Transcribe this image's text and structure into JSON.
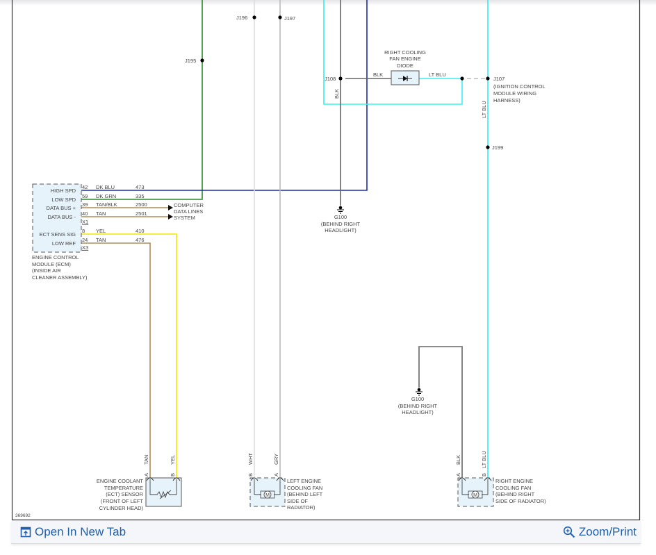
{
  "diagram_id": "369692",
  "colors": {
    "dk_blu": "#1a2fa0",
    "dk_grn": "#2a8a2a",
    "tan": "#b08d57",
    "yel": "#f2e600",
    "lt_blu": "#33f0f0",
    "blk": "#666666",
    "wht": "#dddddd",
    "gry": "#bbbbbb"
  },
  "splices": {
    "j195": "J195",
    "j196": "J196",
    "j197": "J197",
    "j108": "J108",
    "j107": "J107",
    "j199": "J199"
  },
  "j107_desc": [
    "(IGNITION CONTROL",
    "MODULE WIRING",
    "HARNESS)"
  ],
  "diode": {
    "title": [
      "RIGHT COOLING",
      "FAN ENGINE",
      "DIODE"
    ],
    "in_wire": "BLK",
    "out_wire": "LT BLU"
  },
  "vertical_labels": {
    "blk_j108": "BLK",
    "lt_blu_j107": "LT BLU"
  },
  "ground_top": {
    "id": "G100",
    "desc": [
      "(BEHIND RIGHT",
      "HEADLIGHT)"
    ]
  },
  "ground_bottom": {
    "id": "G100",
    "desc": [
      "(BEHIND RIGHT",
      "HEADLIGHT)"
    ]
  },
  "ecm": {
    "pins": [
      {
        "label": "HIGH SPD",
        "pin": "42",
        "color": "DK BLU",
        "circuit": "473"
      },
      {
        "label": "LOW SPD",
        "pin": "59",
        "color": "DK GRN",
        "circuit": "335"
      },
      {
        "label": "DATA BUS +",
        "pin": "39",
        "color": "TAN/BLK",
        "circuit": "2500"
      },
      {
        "label": "DATA BUS -",
        "pin": "40",
        "color": "TAN",
        "circuit": "2501"
      },
      {
        "label": "ECT SENS SIG",
        "pin": "8",
        "color": "YEL",
        "circuit": "410"
      },
      {
        "label": "LOW REF",
        "pin": "24",
        "color": "TAN",
        "circuit": "476"
      }
    ],
    "connectors": [
      "X1",
      "X3"
    ],
    "name": [
      "ENGINE CONTROL",
      "MODULE (ECM)",
      "(INSIDE AIR",
      "CLEANER ASSEMBLY)"
    ]
  },
  "data_lines": [
    "COMPUTER",
    "DATA LINES",
    "SYSTEM"
  ],
  "ect_sensor": {
    "pins": [
      "A",
      "B"
    ],
    "wires": [
      "TAN",
      "YEL"
    ],
    "name": [
      "ENGINE COOLANT",
      "TEMPERATURE",
      "(ECT) SENSOR",
      "(FRONT OF LEFT",
      "CYLINDER HEAD)"
    ]
  },
  "left_fan": {
    "pins": [
      "B",
      "A"
    ],
    "wires": [
      "WHT",
      "GRY"
    ],
    "motor": "M",
    "name": [
      "LEFT ENGINE",
      "COOLING FAN",
      "(BEHIND LEFT",
      "SIDE OF",
      "RADIATOR)"
    ]
  },
  "right_fan": {
    "pins": [
      "A",
      "B"
    ],
    "wires": [
      "BLK",
      "LT BLU"
    ],
    "motor": "M",
    "name": [
      "RIGHT ENGINE",
      "COOLING FAN",
      "(BEHIND RIGHT",
      "SIDE OF RADIATOR)"
    ]
  },
  "footer": {
    "open_tab": "Open In New Tab",
    "zoom_print": "Zoom/Print"
  }
}
